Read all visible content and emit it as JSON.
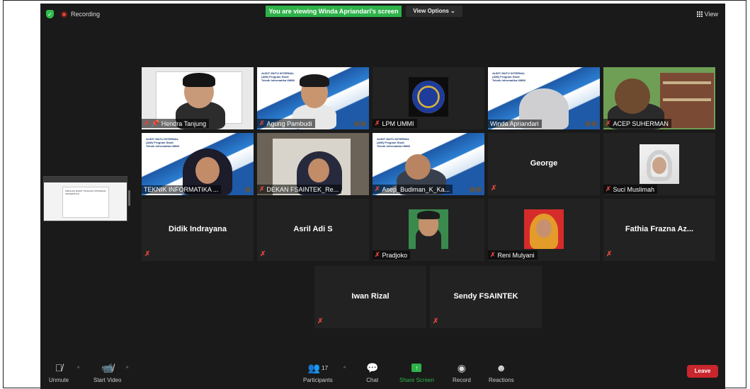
{
  "status": {
    "recording": "Recording"
  },
  "share_banner": "You are viewing Winda Apriandari's screen",
  "view_options": "View Options ⌄",
  "view_label": "View",
  "mini_slide_text": "SIMULASI RAPAT TINJAUAN STRATEGIS UNIVERSITAS",
  "participants": {
    "hendra": "Hendra Tanjung",
    "agung": "Agung Pambudi",
    "lpm": "LPM UMMI",
    "winda": "Winda Apriandari",
    "acep": "ACEP SUHERMAN",
    "teknik": "TEKNIK INFORMATIKA ...",
    "dekan": "DEKAN FSAINTEK_Re...",
    "asep": "Asep_Budiman_K_Ka...",
    "george": "George",
    "suci": "Suci Muslimah",
    "didik": "Didik Indrayana",
    "asril": "Asril Adi S",
    "pradjoko": "Pradjoko",
    "reni": "Reni Mulyani",
    "fathia": "Fathia Frazna Az...",
    "iwan": "Iwan Rizal",
    "sendy": "Sendy FSAINTEK"
  },
  "slide_text": "AUDIT MUTU INTERNAL (AMI) Program Studi Teknik Informatika UMMI",
  "toolbar": {
    "unmute": "Unmute",
    "start_video": "Start Video",
    "participants_count": "17",
    "participants": "Participants",
    "chat": "Chat",
    "share_screen": "Share Screen",
    "record": "Record",
    "reactions": "Reactions",
    "leave": "Leave"
  },
  "colors": {
    "accent_green": "#2db24a",
    "leave_red": "#c9262d",
    "active_border": "#b5e26a"
  }
}
